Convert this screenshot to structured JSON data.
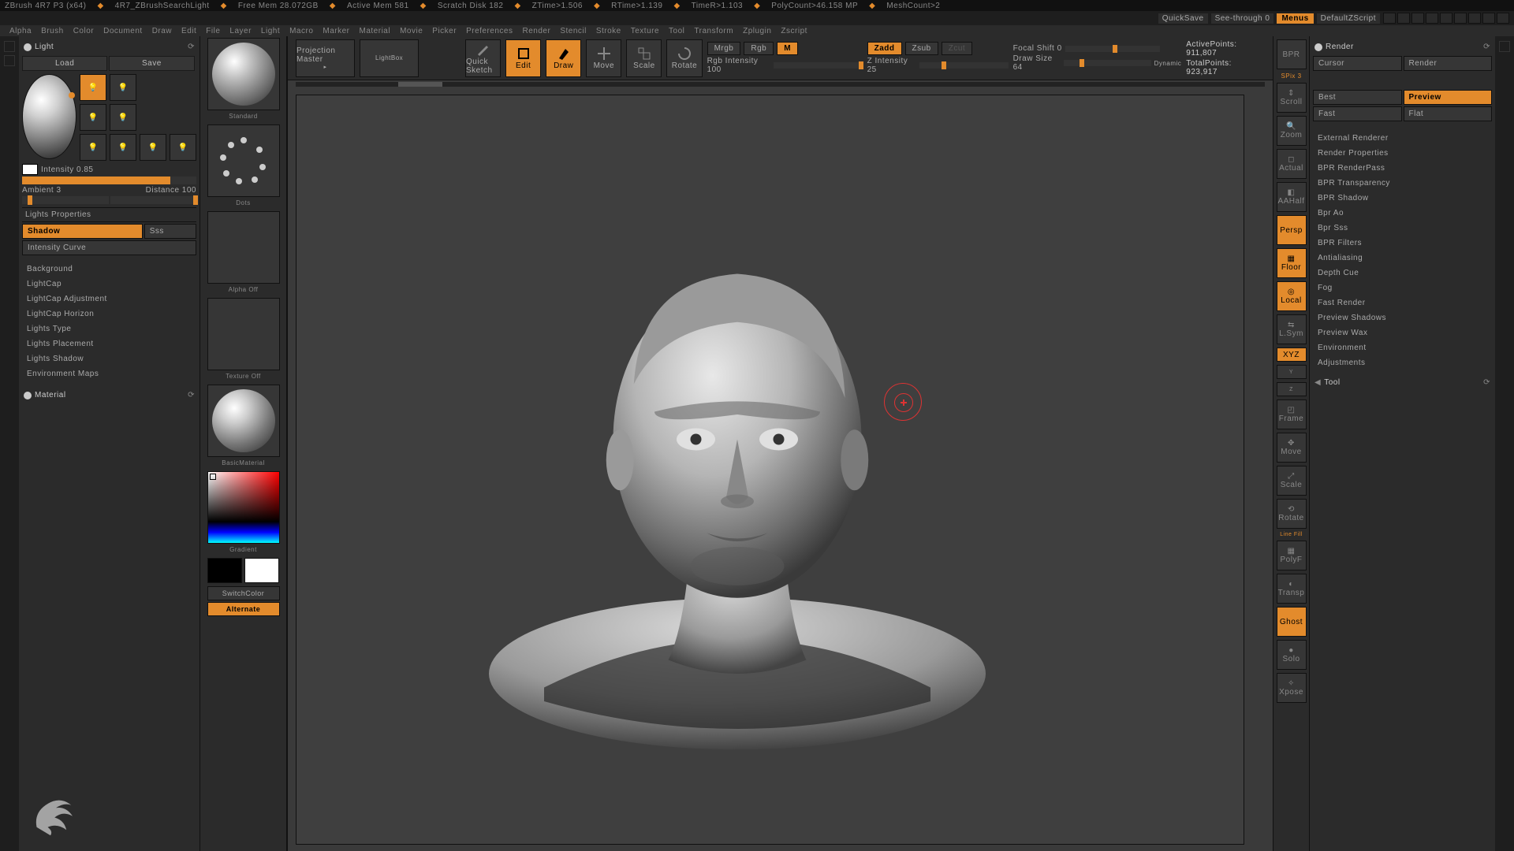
{
  "titlebar": {
    "app": "ZBrush 4R7 P3 (x64)",
    "doc": "4R7_ZBrushSearchLight",
    "stats": [
      "Free Mem 28.072GB",
      "Active Mem 581",
      "Scratch Disk 182",
      "ZTime>1.506",
      "RTime>1.139",
      "TimeR>1.103",
      "PolyCount>46.158 MP",
      "MeshCount>2"
    ]
  },
  "banner": {
    "quicksave": "QuickSave",
    "seethrough": "See-through  0",
    "menus": "Menus",
    "layout": "DefaultZScript"
  },
  "menubar": [
    "Alpha",
    "Brush",
    "Color",
    "Document",
    "Draw",
    "Edit",
    "File",
    "Layer",
    "Light",
    "Macro",
    "Marker",
    "Material",
    "Movie",
    "Picker",
    "Preferences",
    "Render",
    "Stencil",
    "Stroke",
    "Texture",
    "Tool",
    "Transform",
    "Zplugin",
    "Zscript"
  ],
  "left": {
    "title": "Light",
    "load": "Load",
    "save": "Save",
    "intensity_label": "Intensity 0.85",
    "ambient": "Ambient 3",
    "distance": "Distance 100",
    "section_props": "Lights Properties",
    "shadow": "Shadow",
    "sss": "Sss",
    "intensity_curve": "Intensity Curve",
    "items": [
      "Background",
      "LightCap",
      "LightCap Adjustment",
      "LightCap Horizon",
      "Lights Type",
      "Lights Placement",
      "Lights Shadow",
      "Environment Maps"
    ],
    "material_title": "Material"
  },
  "tray": {
    "standard": "Standard",
    "dots": "Dots",
    "alpha": "Alpha Off",
    "texture": "Texture Off",
    "basicmat": "BasicMaterial",
    "gradient": "Gradient",
    "switch": "SwitchColor",
    "alternate": "Alternate"
  },
  "toolbar": {
    "proj": "Projection Master",
    "lightbox": "LightBox",
    "quicksketch": "Quick Sketch",
    "edit": "Edit",
    "draw": "Draw",
    "move": "Move",
    "scale": "Scale",
    "rotate": "Rotate",
    "mrgb": "Mrgb",
    "rgb": "Rgb",
    "m": "M",
    "rgb_int": "Rgb Intensity 100",
    "zadd": "Zadd",
    "zsub": "Zsub",
    "zcut": "Zcut",
    "z_int": "Z Intensity 25",
    "focal": "Focal Shift 0",
    "draw_size": "Draw Size 64",
    "dynamic": "Dynamic",
    "active": "ActivePoints:  911,807",
    "total": "TotalPoints:  923,917"
  },
  "rdock": {
    "items": [
      "BPR",
      "SPix 3",
      "",
      "Scroll",
      "",
      "Zoom",
      "",
      "Actual",
      "",
      "AAHalf",
      "Persp",
      "Floor",
      "Local",
      "",
      "L.Sym",
      "XYZ",
      "",
      "",
      "",
      "Frame",
      "",
      "Move",
      "",
      "Scale",
      "",
      "Rotate",
      "Line Fill",
      "PolyF",
      "",
      "Transp",
      "",
      "Ghost",
      "",
      "Solo",
      "",
      "Xpose"
    ]
  },
  "right": {
    "title": "Render",
    "cursor": "Cursor",
    "render": "Render",
    "best": "Best",
    "preview": "Preview",
    "fast": "Fast",
    "flat": "Flat",
    "items": [
      "External Renderer",
      "Render Properties",
      "BPR RenderPass",
      "BPR Transparency",
      "BPR Shadow",
      "Bpr Ao",
      "Bpr Sss",
      "BPR Filters",
      "Antialiasing",
      "Depth Cue",
      "Fog",
      "Fast Render",
      "Preview Shadows",
      "Preview Wax",
      "Environment",
      "Adjustments"
    ],
    "tool_title": "Tool"
  }
}
